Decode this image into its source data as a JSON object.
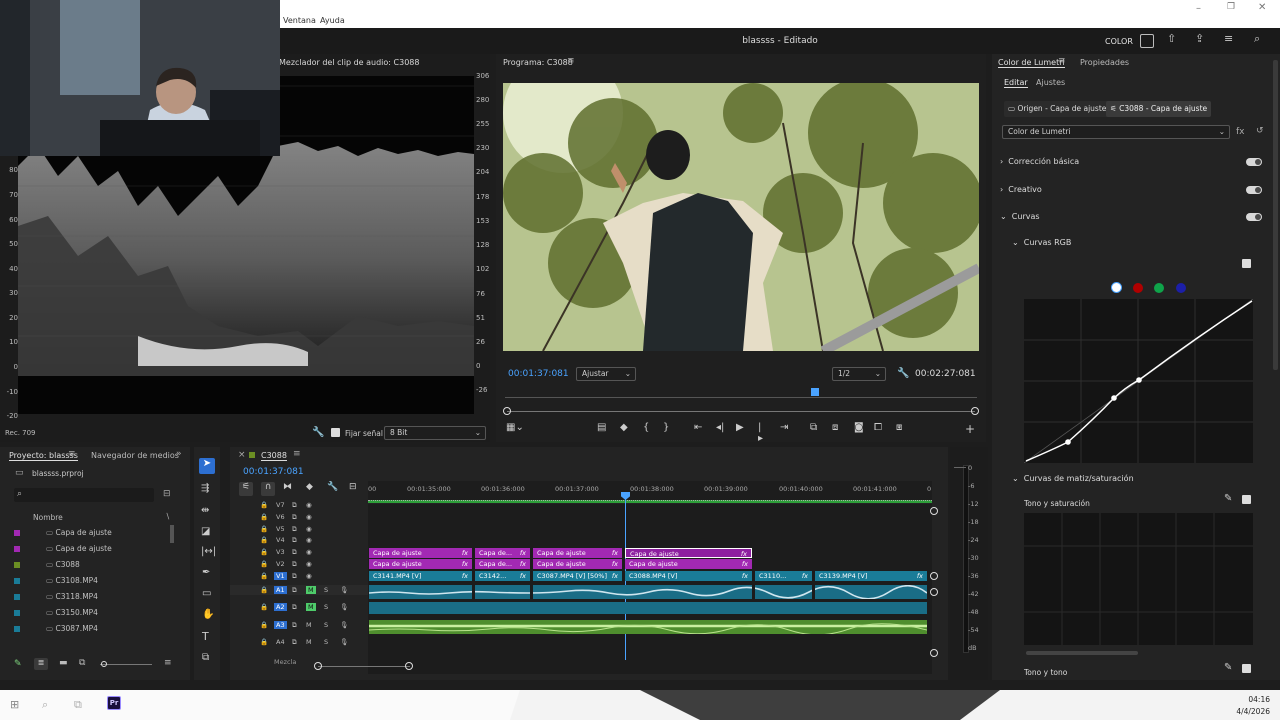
{
  "window": {
    "title": "blassss - Editado",
    "menu_ventana": "Ventana",
    "menu_ayuda": "Ayuda",
    "workspace": "COLOR"
  },
  "scope": {
    "title": "Mezclador del clip de audio: C3088",
    "left_ticks": [
      "80",
      "70",
      "60",
      "50",
      "40",
      "30",
      "20",
      "10",
      "0",
      "-10",
      "-20"
    ],
    "right_ticks": [
      "306",
      "280",
      "255",
      "230",
      "204",
      "178",
      "153",
      "128",
      "102",
      "76",
      "51",
      "26",
      "0",
      "-26"
    ],
    "colorspace": "Rec. 709",
    "clamp_label": "Fijar señal",
    "bit_depth": "8 Bit"
  },
  "program": {
    "title": "Programa: C3088",
    "timecode": "00:01:37:081",
    "fit": "Ajustar",
    "resolution": "1/2",
    "duration": "00:02:27:081"
  },
  "lumetri": {
    "title": "Color de Lumetri",
    "tab_props": "Propiedades",
    "tab_editar": "Editar",
    "tab_ajustes": "Ajustes",
    "source_btn": "Origen - Capa de ajuste",
    "clip_btn": "C3088 - Capa de ajuste",
    "effect": "Color de Lumetri",
    "sections": [
      "Corrección básica",
      "Creativo",
      "Curvas"
    ],
    "curvas_rgb": "Curvas RGB",
    "hue_sat_section": "Curvas de matiz/saturación",
    "hue_sat": "Tono y saturación",
    "hue_hue": "Tono y tono"
  },
  "project": {
    "tab_project": "Proyecto: blassss",
    "tab_media": "Navegador de medios",
    "file": "blassss.prproj",
    "col_name": "Nombre",
    "items": [
      {
        "name": "Capa de ajuste",
        "color": "#a229b3"
      },
      {
        "name": "Capa de ajuste",
        "color": "#a229b3"
      },
      {
        "name": "C3088",
        "color": "#6b8e23"
      },
      {
        "name": "C3108.MP4",
        "color": "#1a7c98"
      },
      {
        "name": "C3118.MP4",
        "color": "#1a7c98"
      },
      {
        "name": "C3150.MP4",
        "color": "#1a7c98"
      },
      {
        "name": "C3087.MP4",
        "color": "#1a7c98"
      }
    ]
  },
  "timeline": {
    "seq_tab": "C3088",
    "timecode": "00:01:37:081",
    "ruler": [
      "00:01:35:000",
      "00:01:36:000",
      "00:01:37:000",
      "00:01:38:000",
      "00:01:39:000",
      "00:01:40:000",
      "00:01:41:000"
    ],
    "ruler_first": "00",
    "ruler_last": "0",
    "video_tracks": [
      "V7",
      "V6",
      "V5",
      "V4",
      "V3",
      "V2",
      "V1"
    ],
    "audio_tracks": [
      "A1",
      "A2",
      "A3",
      "A4"
    ],
    "mix_label": "Mezcla",
    "adjustment_label": "Capa de ajuste",
    "adjustment_short": "Capa de...",
    "clips_v1": [
      "C3141.MP4 [V]",
      "C3142...",
      "C3087.MP4 [V] [50%]",
      "C3088.MP4 [V]",
      "C3110...",
      "C3139.MP4 [V]"
    ]
  },
  "meters": {
    "ticks": [
      "0",
      "-6",
      "-12",
      "-18",
      "-24",
      "-30",
      "-36",
      "-42",
      "-48",
      "-54",
      "dB"
    ]
  },
  "taskbar": {
    "time": "04:16",
    "date": "4/4/2026",
    "app": "Pr"
  },
  "colors": {
    "accent": "#2d8ceb",
    "playhead": "#4aa3ff",
    "adjust": "#a229b3",
    "video": "#1a7c98",
    "audio_green": "#4f8e2e"
  }
}
